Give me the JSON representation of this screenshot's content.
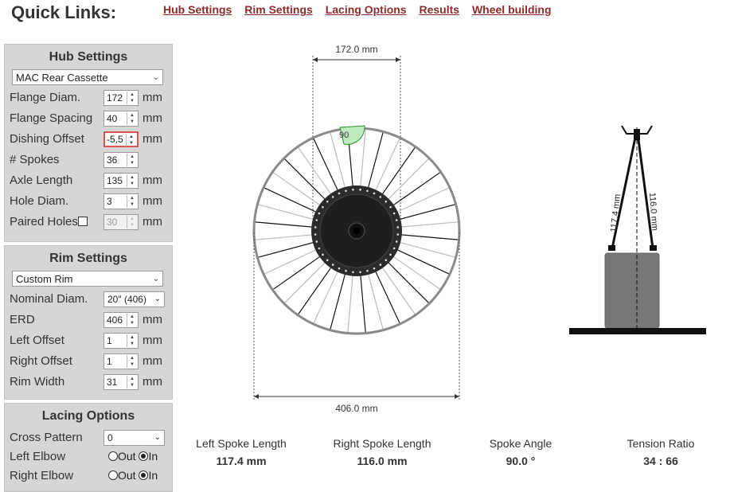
{
  "header": {
    "title": "Quick Links:",
    "links": [
      "Hub Settings",
      "Rim Settings",
      "Lacing Options",
      "Results",
      "Wheel building"
    ]
  },
  "hub": {
    "title": "Hub Settings",
    "preset": "MAC Rear Cassette",
    "fields": [
      {
        "label": "Flange Diam.",
        "value": "172",
        "unit": "mm"
      },
      {
        "label": "Flange Spacing",
        "value": "40",
        "unit": "mm"
      },
      {
        "label": "Dishing Offset",
        "value": "-5,5",
        "unit": "mm"
      },
      {
        "label": "# Spokes",
        "value": "36",
        "unit": ""
      },
      {
        "label": "Axle Length",
        "value": "135",
        "unit": "mm"
      },
      {
        "label": "Hole Diam.",
        "value": "3",
        "unit": "mm"
      },
      {
        "label": "Paired Holes",
        "value": "30",
        "unit": "mm"
      }
    ]
  },
  "rim": {
    "title": "Rim Settings",
    "preset": "Custom Rim",
    "nominal_label": "Nominal Diam.",
    "nominal_value": "20\" (406)",
    "fields": [
      {
        "label": "ERD",
        "value": "406",
        "unit": "mm"
      },
      {
        "label": "Left Offset",
        "value": "1",
        "unit": "mm"
      },
      {
        "label": "Right Offset",
        "value": "1",
        "unit": "mm"
      },
      {
        "label": "Rim Width",
        "value": "31",
        "unit": "mm"
      }
    ]
  },
  "lacing": {
    "title": "Lacing Options",
    "cross_label": "Cross Pattern",
    "cross_value": "0",
    "left_elbow_label": "Left Elbow",
    "right_elbow_label": "Right Elbow",
    "out": "Out",
    "in": "In",
    "left_elbow": "In",
    "right_elbow": "In"
  },
  "diagram": {
    "flange_dim": "172.0 mm",
    "rim_dim": "406.0 mm",
    "angle_label": "90",
    "left_spoke_side": "117.4 mm",
    "right_spoke_side": "116.0 mm"
  },
  "results": [
    {
      "label": "Left Spoke Length",
      "value": "117.4 mm"
    },
    {
      "label": "Right Spoke Length",
      "value": "116.0 mm"
    },
    {
      "label": "Spoke Angle",
      "value": "90.0 °"
    },
    {
      "label": "Tension Ratio",
      "value": "34 : 66"
    }
  ],
  "colors": {
    "link": "#8b2c2c",
    "panel": "#d6d6d6",
    "error_border": "#d9534f",
    "hub": "#2b2b2b",
    "rim": "#888888"
  }
}
